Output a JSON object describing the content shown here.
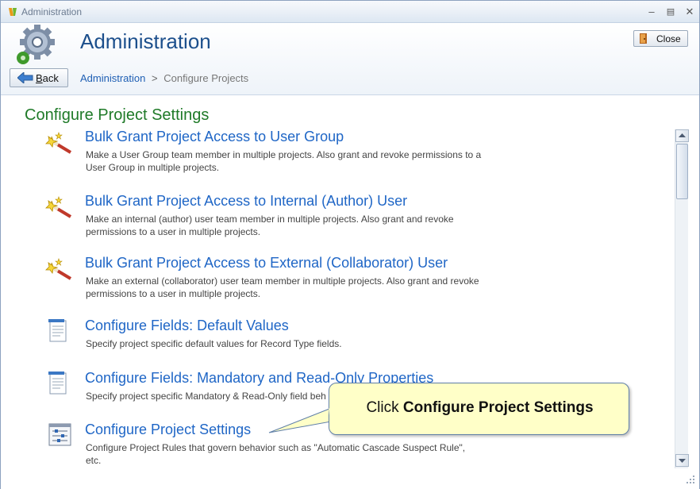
{
  "window": {
    "title": "Administration"
  },
  "header": {
    "title": "Administration",
    "close_label": "Close",
    "back_label": "Back",
    "back_mnemonic": "B",
    "back_rest": "ack"
  },
  "breadcrumb": {
    "root": "Administration",
    "separator": ">",
    "current": "Configure Projects"
  },
  "section": {
    "title": "Configure Project Settings"
  },
  "items": [
    {
      "title": "Bulk Grant Project Access to User Group",
      "desc": "Make a User Group team member in multiple projects. Also grant and revoke permissions to a User Group in multiple projects.",
      "icon": "magic-wand-icon"
    },
    {
      "title": "Bulk Grant Project Access to Internal (Author) User",
      "desc": "Make an internal (author) user team member in multiple projects. Also grant and revoke permissions to a user in multiple projects.",
      "icon": "magic-wand-icon"
    },
    {
      "title": "Bulk Grant Project Access to External (Collaborator) User",
      "desc": "Make an external (collaborator) user team member in multiple projects. Also grant and revoke permissions to a user in multiple projects.",
      "icon": "magic-wand-icon"
    },
    {
      "title": "Configure Fields: Default Values",
      "desc": "Specify project specific default values for Record Type fields.",
      "icon": "document-icon"
    },
    {
      "title": "Configure Fields: Mandatory and Read-Only Properties",
      "desc": "Specify project specific Mandatory & Read-Only field beh",
      "icon": "document-icon"
    },
    {
      "title": "Configure Project Settings",
      "desc": "Configure Project Rules that govern behavior such as \"Automatic Cascade Suspect Rule\", etc.",
      "icon": "settings-sliders-icon"
    }
  ],
  "callout": {
    "prefix": "Click ",
    "emphasis": "Configure Project Settings"
  },
  "colors": {
    "title_blue": "#1c4f8c",
    "link_blue": "#1f66c6",
    "section_green": "#1f7a28",
    "callout_bg": "#ffffc8"
  }
}
